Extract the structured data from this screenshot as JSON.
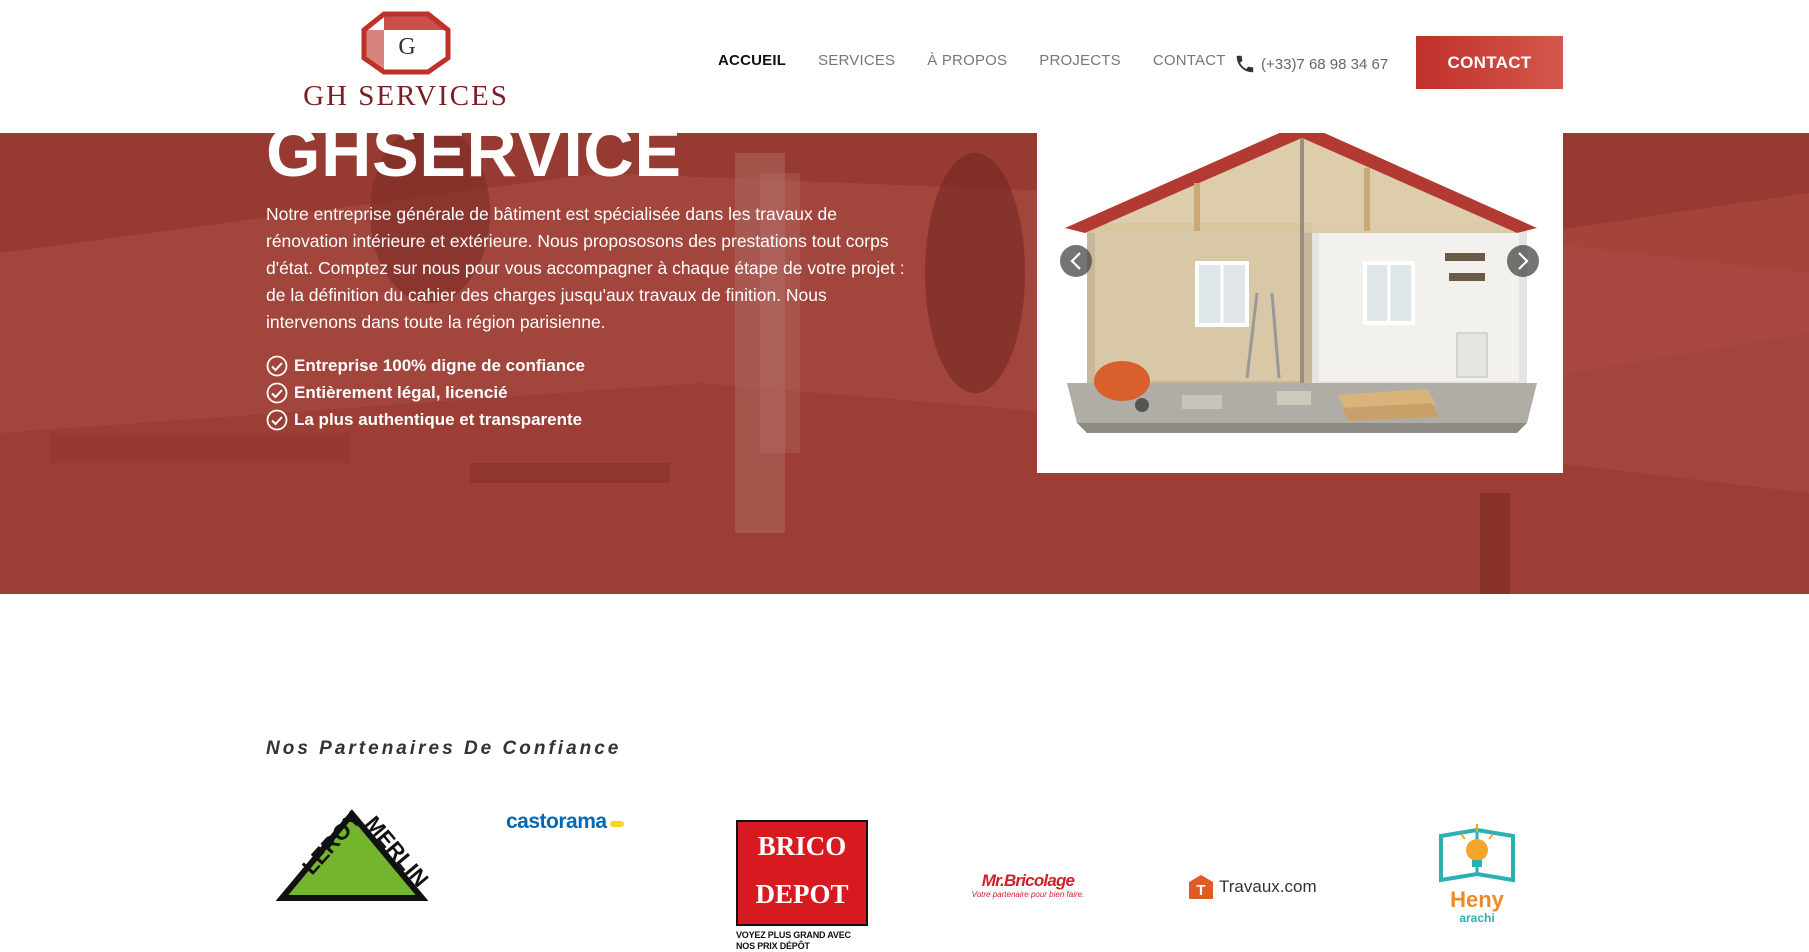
{
  "header": {
    "logo_text": "GH SERVICES",
    "nav": [
      {
        "label": "ACCUEIL",
        "active": true
      },
      {
        "label": "SERVICES",
        "active": false
      },
      {
        "label": "À PROPOS",
        "active": false
      },
      {
        "label": "PROJECTS",
        "active": false
      },
      {
        "label": "CONTACT",
        "active": false
      }
    ],
    "phone": "(+33)7 68 98 34 67",
    "contact_button": "CONTACT"
  },
  "hero": {
    "title": "GHSERVICE",
    "text": "Notre entreprise générale de bâtiment est spécialisée dans les travaux de rénovation intérieure et extérieure. Nous propososons des prestations tout corps d'état. Comptez sur nous pour vous accompagner à chaque étape de votre projet : de la définition du cahier des charges jusqu'aux travaux de finition. Nous intervenons dans toute la région parisienne.",
    "features": [
      "Entreprise 100% digne de confiance",
      "Entièrement légal, licencié",
      "La plus authentique et transparente"
    ]
  },
  "partners": {
    "title": "Nos Partenaires De Confiance",
    "logos": [
      {
        "name": "LEROY MERLIN"
      },
      {
        "name": "castorama"
      },
      {
        "name": "BRICO DEPOT",
        "tagline": "VOYEZ PLUS GRAND AVEC NOS PRIX DÉPÔT"
      },
      {
        "name": "Mr.Bricolage",
        "tagline": "Votre partenaire pour bien faire."
      },
      {
        "name": "Travaux.com"
      },
      {
        "name": "Heny",
        "sub": "arachi"
      }
    ]
  },
  "colors": {
    "brand_red": "#c0302a",
    "logo_maroon": "#7a1f23",
    "hero_overlay": "#962d26"
  }
}
